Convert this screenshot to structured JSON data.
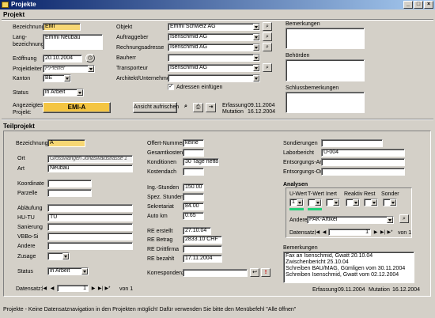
{
  "window": {
    "title": "Projekte"
  },
  "projekt": {
    "header": "Projekt",
    "bezeichnung_label": "Bezeichnung",
    "bezeichnung": "EMI",
    "lang_label": "Lang-\nbezeichnung",
    "lang": "Emmi Neubau",
    "eroeffnung_label": "Eröffnung",
    "eroeffnung": "20.10.2004",
    "projektleiter_label": "Projektleiter",
    "projektleiter": "P.Pfeiffer",
    "kanton_label": "Kanton",
    "kanton": "BE",
    "status_label": "Status",
    "status": "in Arbeit",
    "angezeigtes_label": "Angezeigtes\nProjekt:",
    "angezeigtes": "EMI-A",
    "objekt_label": "Objekt",
    "objekt": "Emmi Schweiz AG",
    "auftraggeber_label": "Auftraggeber",
    "auftraggeber": "Isenschmid AG",
    "rechnungsadresse_label": "Rechnungsadresse",
    "rechnungsadresse": "Isenschmid AG",
    "bauherr_label": "Bauherr",
    "bauherr": "",
    "transporteur_label": "Transporteur",
    "transporteur": "Isenschmid AG",
    "architekt_label": "Architekt/Unternehmer",
    "architekt": "",
    "adressen_label": "Adressen einfügen",
    "adressen_checked": true,
    "ansicht_button": "Ansicht aufrischen",
    "erfassung_label": "Erfassung",
    "erfassung": "09.11.2004",
    "mutation_label": "Mutation",
    "mutation": "16.12.2004",
    "bemerkungen_label": "Bemerkungen",
    "behoerden_label": "Behörden",
    "schluss_label": "Schlussbemerkungen"
  },
  "teilprojekt": {
    "header": "Teilprojekt",
    "bezeichnung_label": "Bezeichnung",
    "bezeichnung": "A",
    "ort_label": "Ort",
    "ort": "Grosswangen Jonaswaldstrasse 1",
    "art_label": "Art",
    "art": "Neubau",
    "koordinate_label": "Koordinate",
    "parzelle_label": "Parzelle",
    "ablaeufe_label": "Abläufung",
    "hutu_label": "HU-TU",
    "hutu": "TU",
    "sanierung_label": "Sanierung",
    "vbbo_label": "VBBo-Si",
    "andere_label": "Andere",
    "zusage_label": "Zusage",
    "status_label": "Status",
    "status": "in Arbeit",
    "offert_label": "Offert-Nummer",
    "offert": "keine",
    "gesamtkosten_label": "Gesamtkosten",
    "gesamtkosten": "",
    "konditionen_label": "Konditionen",
    "konditionen": "30 Tage netto",
    "kostendach_label": "Kostendach",
    "kostendach": "",
    "ing_label": "Ing.-Stunden",
    "ing": "150.00",
    "spez_label": "Spez. Stunden",
    "spez": "",
    "sekretariat_label": "Sekretariat",
    "sekretariat": "84.00",
    "autokm_label": "Auto km",
    "autokm": "0.65",
    "re_erstellt_label": "RE erstellt",
    "re_erstellt": "27.10.04",
    "re_betrag_label": "RE Betrag",
    "re_betrag": "2833.10 CHF",
    "re_drittfirma_label": "RE Drittfirma",
    "re_drittfirma": "",
    "re_bezahlt_label": "RE bezahlt",
    "re_bezahlt": "17.11.2004",
    "korrespondenz_label": "Korrespondenz",
    "sondierungen_label": "Sondierungen",
    "laborbericht_label": "Laborbericht",
    "laborbericht": "U-004",
    "entsorgungs_art_label": "Entsorgungs-Art",
    "entsorgungs_ort_label": "Entsorgungs-Ort",
    "analysen_label": "Analysen",
    "analysen_cols": [
      "U-Wert",
      "T-Wert",
      "Inert",
      "Reaktiv",
      "Rest",
      "Sonder"
    ],
    "analysen_first": "1",
    "andere_label2": "Andere",
    "andere2": "PAK-Artikel",
    "datensatz_label": "Datensatz:",
    "analysen_nav_num": "1",
    "analysen_nav_von": "von  1",
    "bemerkungen_label": "Bemerkungen",
    "bemerkungen": "Fax an Isenschmid, Gwatt 20.10.04\nZwischenbericht 25.10.04\nSchreiben BAU/MAG, Gümligen vom 30.11.2004\nSchreiben Isenschmid, Gwatt vom 02.12.2004",
    "erfassung_label": "Erfassung",
    "erfassung": "09.11.2004",
    "mutation_label": "Mutation",
    "mutation": "16.12.2004",
    "nav_label": "Datensatz:",
    "nav_num": "1",
    "nav_von": "von  1"
  },
  "statusbar": "Projekte - Keine Datensatznavigation in den Projekten möglich! Dafür verwenden Sie bitte den Menübefehl \"Alle öffnen\"",
  "colors": {
    "accent_yellow": "#f7d774",
    "button_gold": "#f4c542",
    "title_blue": "#0a246a",
    "analysis_green": "#21d07a"
  }
}
